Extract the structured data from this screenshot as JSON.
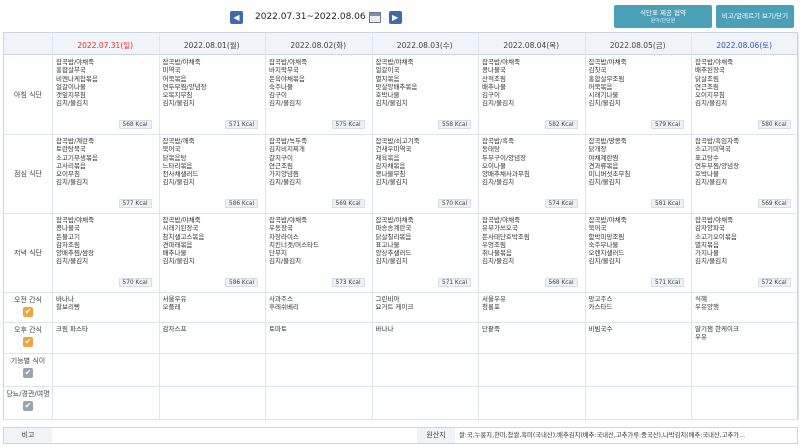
{
  "nav": {
    "prev_icon": "chevron-left-icon",
    "next_icon": "chevron-right-icon",
    "range": "2022.07.31~2022.08.06",
    "calendar_icon": "calendar-icon"
  },
  "buttons": {
    "b1_title": "식단표 제공 협약",
    "b1_sub": "원아/단단원",
    "b2": "비고/알레르기 보기/닫기"
  },
  "days": [
    {
      "label": "2022.07.31(일)",
      "type": "sun"
    },
    {
      "label": "2022.08.01(월)",
      "type": ""
    },
    {
      "label": "2022.08.02(화)",
      "type": ""
    },
    {
      "label": "2022.08.03(수)",
      "type": ""
    },
    {
      "label": "2022.08.04(목)",
      "type": ""
    },
    {
      "label": "2022.08.05(금)",
      "type": ""
    },
    {
      "label": "2022.08.06(토)",
      "type": "sat"
    }
  ],
  "rows": {
    "breakfast": "아침 식단",
    "lunch": "점심 식단",
    "dinner": "저녁 식단",
    "am_snack": "오전 간식",
    "pm_snack": "오후 간식",
    "functional": "기능별 식이",
    "diabetes": "당뇨/경관/여명"
  },
  "breakfast": [
    {
      "items": "잡곡밥/야채죽\n홍합살무국\n비엔나케찹볶음\n얼갈이나물\n갯잎지무침\n김치/물김치",
      "kcal": "568 Kcal"
    },
    {
      "items": "잡곡밥/야채죽\n미역국\n어묵볶음\n연두부찜/양념장\n오복지무침\n김치/물김치",
      "kcal": "571 Kcal"
    },
    {
      "items": "잡곡밥/야채죽\n바지락무국\n돈육야채볶음\n숙주나물\n김구이\n김치/물김치",
      "kcal": "575 Kcal"
    },
    {
      "items": "잡곡밥/야채죽\n얼갈이국\n멸치볶음\n맛살양배추볶음\n호박나물\n김치/물김치",
      "kcal": "558 Kcal"
    },
    {
      "items": "잡곡밥/야채죽\n콩나물국\n산적조림\n배추나물\n김구이\n김치/물김치",
      "kcal": "582 Kcal"
    },
    {
      "items": "잡곡밥/야채죽\n김칫국\n홍합살무조림\n어묵볶음\n시래기나물\n김치/물김치",
      "kcal": "579 Kcal"
    },
    {
      "items": "잡곡밥/야채죽\n배추된장국\n닭살조림\n연근조림\n오이지무침\n김치/물김치",
      "kcal": "580 Kcal"
    }
  ],
  "lunch": [
    {
      "items": "잡곡밥/계란죽\n토란탕북국\n소고기무생볶음\n고사리볶음\n오이무침\n김치/물김치",
      "kcal": "577 Kcal"
    },
    {
      "items": "잡곡밥/깨죽\n북어국\n닭볶음탕\n느타리볶음\n천사채샐러드\n김치/물김치",
      "kcal": "586 Kcal"
    },
    {
      "items": "잡곡밥/녹두죽\n김치비지찌개\n갈치구이\n연근조림\n가지양념찜\n김치/물김치",
      "kcal": "569 Kcal"
    },
    {
      "items": "잡곡밥/쇠고기죽\n건새우미역국\n제육볶음\n감자채볶음\n콩나물무침\n김치/물김치",
      "kcal": "570 Kcal"
    },
    {
      "items": "잡곡밥/흑죽\n동태탕\n두부구이/양념장\n오이나물\n양배추채사과무침\n김치/물김치",
      "kcal": "574 Kcal"
    },
    {
      "items": "잡곡밥/땅콩죽\n닭개장\n야채계란찜\n견과류볶음\n미니버섯초무침\n김치/물김치",
      "kcal": "581 Kcal"
    },
    {
      "items": "잡곡밥/흑임자죽\n소고기미역국\n표고탕수\n연두부찜/양념장\n호박나물\n김치/물김치",
      "kcal": "569 Kcal"
    }
  ],
  "dinner": [
    {
      "items": "잡곡밥/야채죽\n콩나물국\n돈불고기\n감자조림\n양배추찜/쌈장\n김치/물김치",
      "kcal": "570 Kcal"
    },
    {
      "items": "잡곡밥/야채죽\n시래기된장국\n참치샐고스볶음\n견파래볶음\n배추나물\n김치/물김치",
      "kcal": "586 Kcal"
    },
    {
      "items": "잡곡밥/야채죽\n우동장국\n차장라이스\n치킨너겟/머스타드\n단무지\n김치/물김치",
      "kcal": "573 Kcal"
    },
    {
      "items": "잡곡밥/야채죽\n파송송계란국\n닭살칠리볶음\n표고나물\n양상추샐러드\n김치/물김치",
      "kcal": "571 Kcal"
    },
    {
      "items": "잡곡밥/야채죽\n유부가쓰오국\n돈사태단호박조림\n우엉조림\n취나물볶음\n김치/물김치",
      "kcal": "568 Kcal"
    },
    {
      "items": "잡곡밥/야채죽\n북어국\n함박피망조림\n숙주무나물\n오렌지샐러드\n김치/물김치",
      "kcal": "571 Kcal"
    },
    {
      "items": "잡곡밥/야채죽\n감자양파국\n소고기오이볶음\n멸치볶음\n가지나물\n김치/물김치",
      "kcal": "572 Kcal"
    }
  ],
  "am_snack": [
    "바나나\n찰보리빵",
    "서울우유\n오플레",
    "사과주스\n후레쉬베리",
    "그린비아\n요거트 케이크",
    "서울우유\n청룡포",
    "망고주스\n카스타드",
    "식혜\n우유양행"
  ],
  "pm_snack": [
    "크림 파스타",
    "감자스프",
    "토마토",
    "바나나",
    "단팥죽",
    "비빔국수",
    "딸기잼 한케이크\n우유"
  ],
  "footer": {
    "note_label": "비고",
    "origin_label": "원산지",
    "origin_text": "쌀:국,누룽지,현미,찹쌀,흑미(국내산),배추김치(배추:국내산,고추가루:중국산),나박김치(배추:국내산,고추가..."
  }
}
